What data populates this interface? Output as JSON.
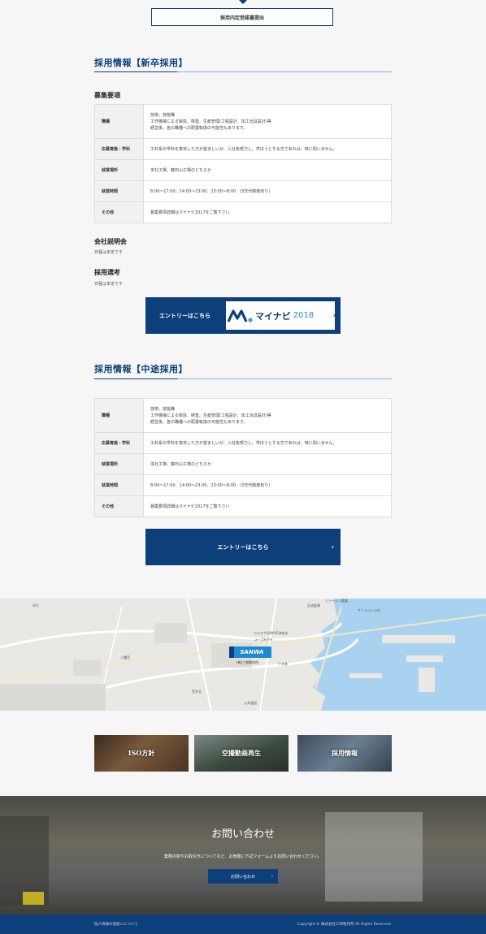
{
  "top": {
    "button": "採用内定受諾書提出"
  },
  "new_grad": {
    "title": "採用情報【新卒採用】",
    "requirements_heading": "募集要項",
    "rows": [
      {
        "key": "職種",
        "value_lines": [
          "技術、技能職",
          "工作機械による製造、検査、生産管理(工程設計、加工治具設計)等",
          "経営後、各の職種への配置転換の可能性もあります。"
        ]
      },
      {
        "key": "応募資格・学科",
        "value_lines": [
          "工科系の学科を専攻した方が望ましいが、入社後努力し、学ぼうとする方であれば、特に問いません。"
        ]
      },
      {
        "key": "就業場所",
        "value_lines": [
          "本社工場、藤石山工場のどちらか"
        ]
      },
      {
        "key": "就業時間",
        "value_lines": [
          "8:00〜17:00、14:00〜23:00、23:00〜8:00　(3交代制度有り)"
        ]
      },
      {
        "key": "その他",
        "value_lines": [
          "募集要項詳細はマイナビ2017をご覧下さい"
        ]
      }
    ],
    "briefing_heading": "会社説明会",
    "briefing_text": "日程は未定です",
    "selection_heading": "採用選考",
    "selection_text": "日程は未定です",
    "entry_label": "エントリーはこちら",
    "mynavi_text": "マイナビ",
    "mynavi_year": "2018"
  },
  "mid_career": {
    "title": "採用情報【中途採用】",
    "rows": [
      {
        "key": "職種",
        "value_lines": [
          "技術、技能職",
          "工作機械による製造、検査、生産管理(工程設計、加工治具設計)等",
          "経営後、各の職種への配置転換の可能性もあります。"
        ]
      },
      {
        "key": "応募資格・学科",
        "value_lines": [
          "工科系の学科を専攻した方が望ましいが、入社後努力し、学ぼうとする方であれば、特に問いません。"
        ]
      },
      {
        "key": "就業場所",
        "value_lines": [
          "本社工場、藤石山工場のどちらか"
        ]
      },
      {
        "key": "就業時間",
        "value_lines": [
          "8:00〜17:00、14:00〜23:00、23:00〜8:00　(3交代制度有り)"
        ]
      },
      {
        "key": "その他",
        "value_lines": [
          "募集要項詳細はマイナビ2017をご覧下さい"
        ]
      }
    ],
    "entry_label": "エントリーはこちら"
  },
  "map": {
    "marker": "SANWA",
    "marker_sub": "(株)三和製作所",
    "labels": [
      "石油倉庫",
      "サンライト公社",
      "カラオケ&WAVE津松店",
      "コープみやぎ",
      "ワタ鉄",
      "市大",
      "ジョーシン電器",
      "八幡宮",
      "荒井北",
      "公共施設"
    ]
  },
  "thumbs": [
    {
      "label": "ISO方針"
    },
    {
      "label": "空撮動画再生"
    },
    {
      "label": "採用情報"
    }
  ],
  "contact": {
    "title": "お問い合わせ",
    "desc": "業務内容やお取引きについてなど、お気軽に下記フォームよりお問い合わせください。",
    "button": "お問い合わせ"
  },
  "footer": {
    "privacy": "個人情報の取扱いについて",
    "copyright": "Copyright © 株式会社三和製作所 All Rights Reserved."
  },
  "colors": {
    "brand": "#0d3f7a",
    "accent_light": "#7fb6e8",
    "map_water": "#a9d2f1"
  },
  "icons": [
    "chevron-right-icon",
    "map-pin-icon"
  ]
}
